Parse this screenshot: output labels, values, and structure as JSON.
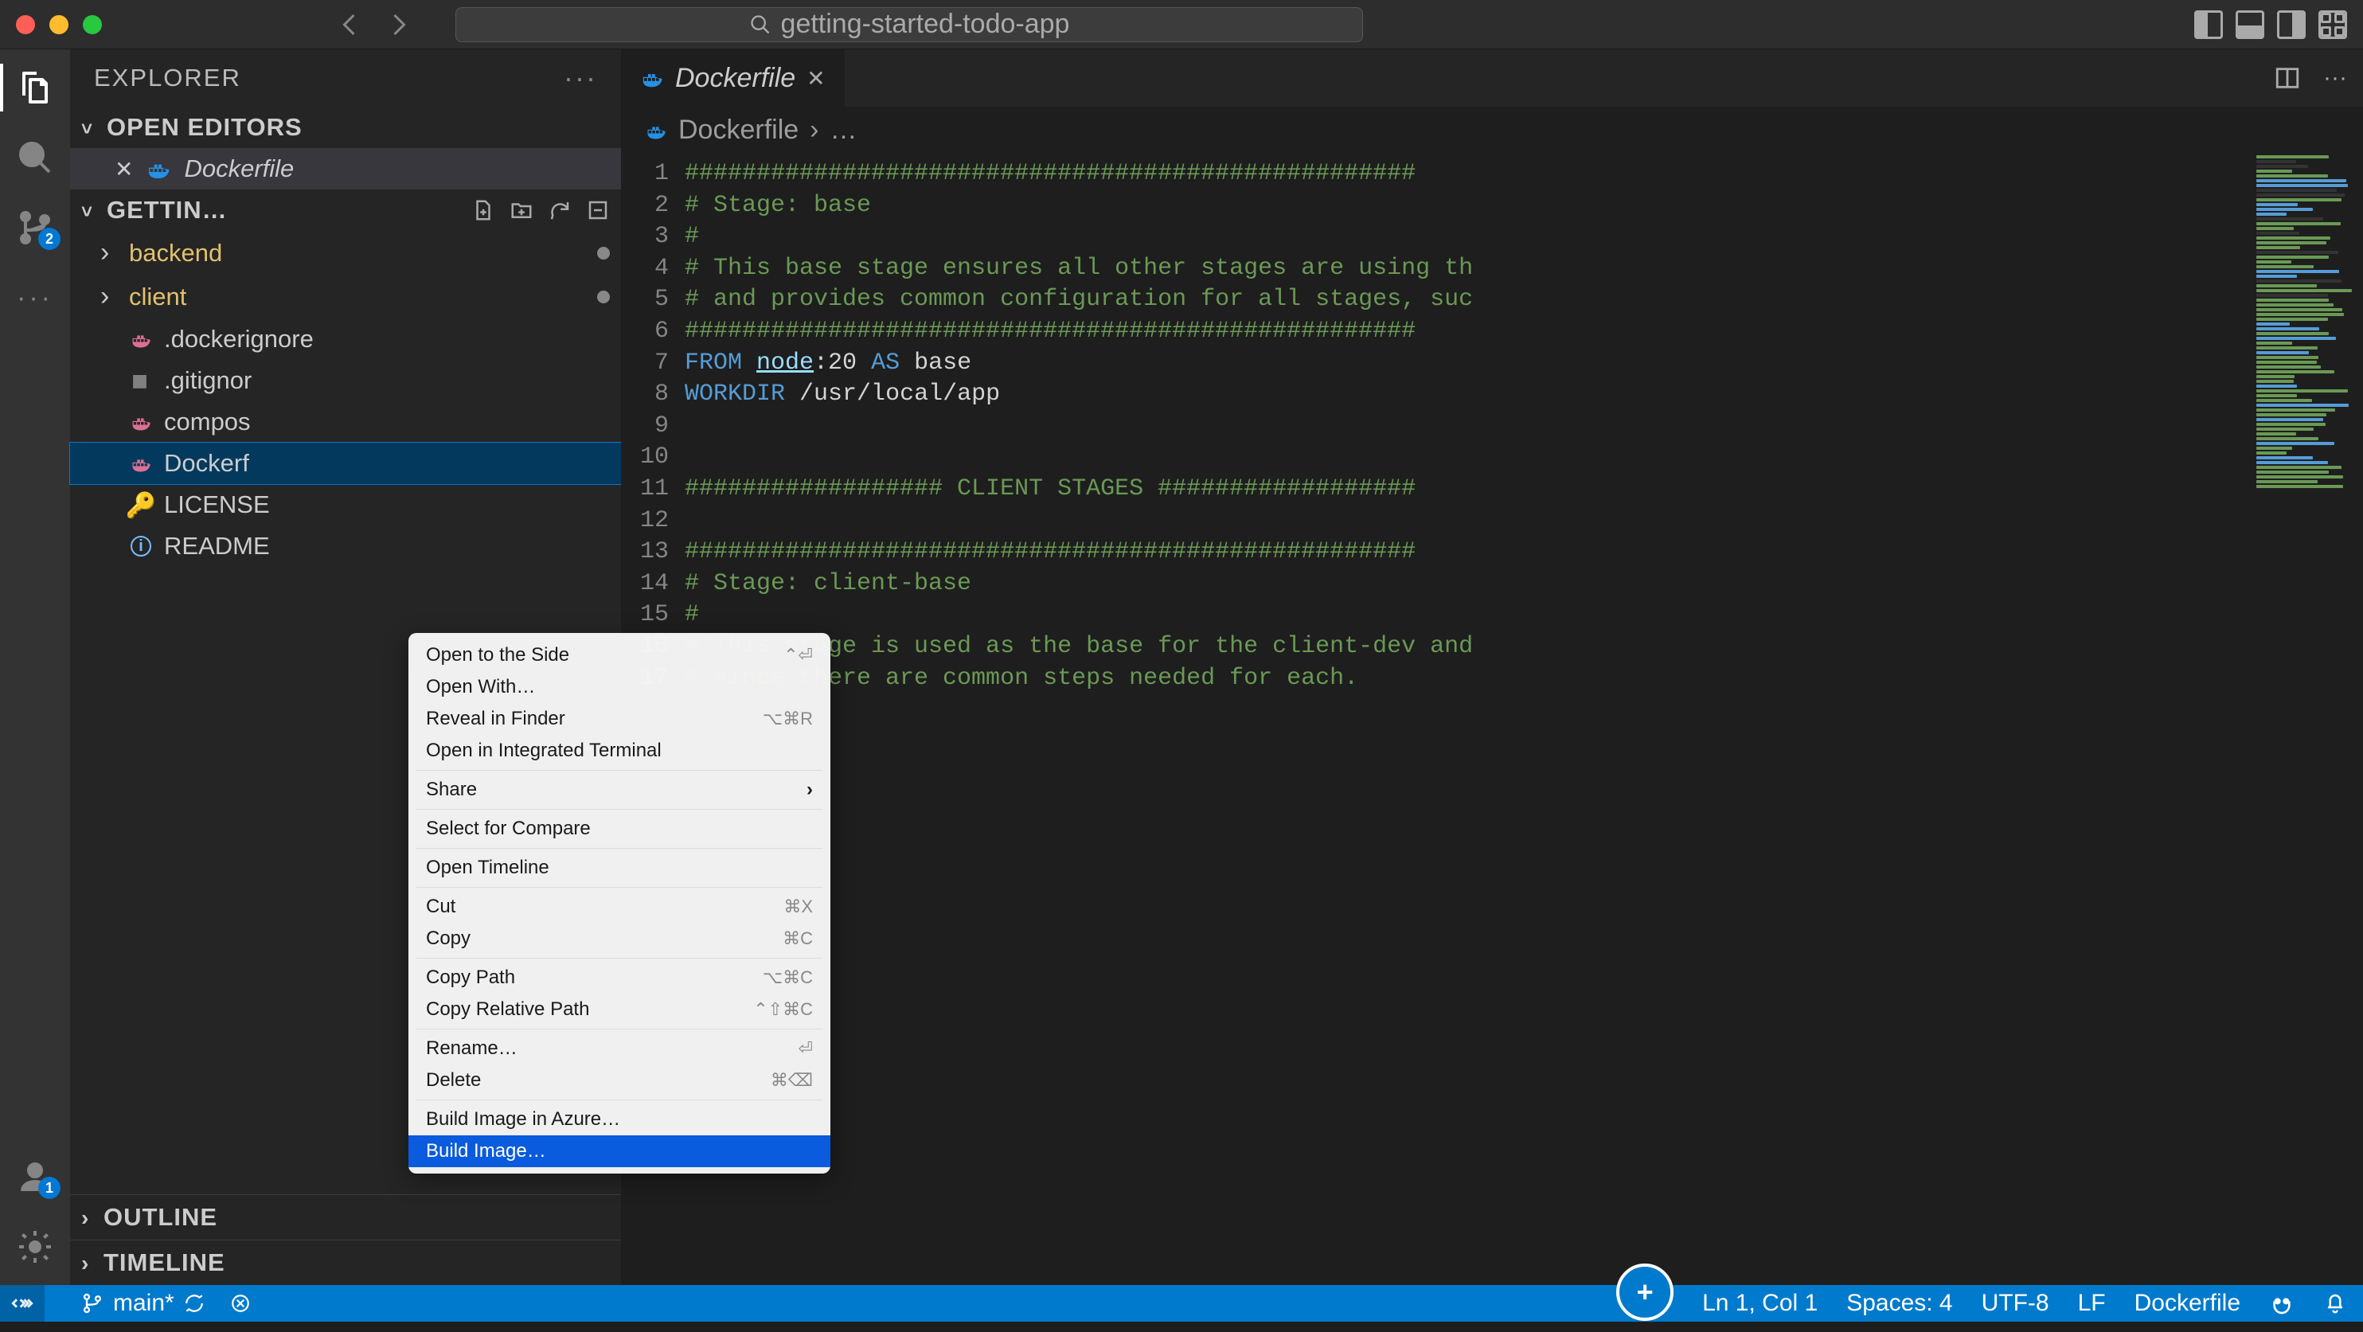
{
  "window": {
    "search_text": "getting-started-todo-app"
  },
  "activity": {
    "scm_badge": "2",
    "account_badge": "1"
  },
  "sidebar": {
    "title": "EXPLORER",
    "open_editors_label": "OPEN EDITORS",
    "open_editor_file": "Dockerfile",
    "workspace_label": "GETTIN…",
    "items": [
      {
        "label": "backend",
        "type": "folder",
        "modified": true
      },
      {
        "label": "client",
        "type": "folder",
        "modified": true
      },
      {
        "label": ".dockerignore",
        "type": "docker"
      },
      {
        "label": ".gitignor",
        "type": "git"
      },
      {
        "label": "compos",
        "type": "docker"
      },
      {
        "label": "Dockerf",
        "type": "docker",
        "selected": true
      },
      {
        "label": "LICENSE",
        "type": "license"
      },
      {
        "label": "README",
        "type": "info"
      }
    ],
    "outline_label": "OUTLINE",
    "timeline_label": "TIMELINE"
  },
  "tab": {
    "title": "Dockerfile"
  },
  "breadcrumb": {
    "file": "Dockerfile",
    "rest": "…"
  },
  "code": {
    "lines": [
      "###################################################",
      "# Stage: base",
      "#",
      "# This base stage ensures all other stages are using th",
      "# and provides common configuration for all stages, suc",
      "###################################################",
      "FROM node:20 AS base",
      "WORKDIR /usr/local/app",
      "",
      "",
      "################## CLIENT STAGES ##################",
      "",
      "###################################################",
      "# Stage: client-base",
      "#",
      "# This stage is used as the base for the client-dev and",
      "# since there are common steps needed for each."
    ]
  },
  "context_menu": {
    "items": [
      {
        "label": "Open to the Side",
        "shortcut": "⌃⏎"
      },
      {
        "label": "Open With…"
      },
      {
        "label": "Reveal in Finder",
        "shortcut": "⌥⌘R"
      },
      {
        "label": "Open in Integrated Terminal"
      },
      {
        "sep": true
      },
      {
        "label": "Share",
        "submenu": true
      },
      {
        "sep": true
      },
      {
        "label": "Select for Compare"
      },
      {
        "sep": true
      },
      {
        "label": "Open Timeline"
      },
      {
        "sep": true
      },
      {
        "label": "Cut",
        "shortcut": "⌘X"
      },
      {
        "label": "Copy",
        "shortcut": "⌘C"
      },
      {
        "sep": true
      },
      {
        "label": "Copy Path",
        "shortcut": "⌥⌘C"
      },
      {
        "label": "Copy Relative Path",
        "shortcut": "⌃⇧⌘C"
      },
      {
        "sep": true
      },
      {
        "label": "Rename…",
        "shortcut": "⏎"
      },
      {
        "label": "Delete",
        "shortcut": "⌘⌫"
      },
      {
        "sep": true
      },
      {
        "label": "Build Image in Azure…"
      },
      {
        "label": "Build Image…",
        "highlight": true
      }
    ]
  },
  "status": {
    "branch": "main*",
    "cursor": "Ln 1, Col 1",
    "spaces": "Spaces: 4",
    "encoding": "UTF-8",
    "eol": "LF",
    "lang": "Dockerfile"
  },
  "colors": {
    "accent": "#007acc"
  }
}
